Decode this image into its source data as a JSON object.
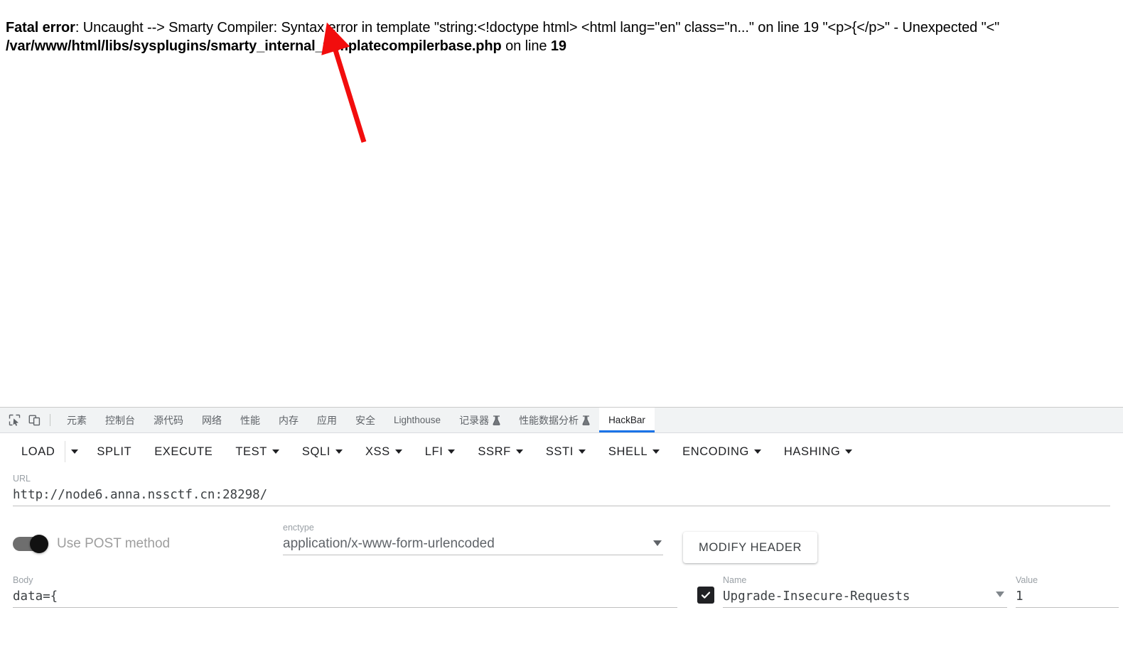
{
  "page": {
    "error": {
      "line1_segments": [
        {
          "text": "Fatal error",
          "bold": true
        },
        {
          "text": ": Uncaught --> Smarty Compiler: Syntax error in template \"string:<!doctype html>  <html lang=\"en\" class=\"n...\" on line 19 \"<p>{</p>\" - Unexpected \"<\"",
          "bold": false
        }
      ],
      "line2_segments": [
        {
          "text": "/var/www/html/libs/sysplugins/smarty_internal_templatecompilerbase.php",
          "bold": true
        },
        {
          "text": " on line ",
          "bold": false
        },
        {
          "text": "19",
          "bold": true
        }
      ]
    },
    "annotation": {
      "arrow_color": "#f20d0d"
    }
  },
  "devtools": {
    "icons": [
      {
        "name": "inspect-element-icon",
        "label": "Inspect element"
      },
      {
        "name": "device-toolbar-icon",
        "label": "Toggle device toolbar"
      }
    ],
    "tabs": [
      {
        "label": "元素",
        "active": false,
        "flask": false,
        "cjk": true
      },
      {
        "label": "控制台",
        "active": false,
        "flask": false,
        "cjk": true
      },
      {
        "label": "源代码",
        "active": false,
        "flask": false,
        "cjk": true
      },
      {
        "label": "网络",
        "active": false,
        "flask": false,
        "cjk": true
      },
      {
        "label": "性能",
        "active": false,
        "flask": false,
        "cjk": true
      },
      {
        "label": "内存",
        "active": false,
        "flask": false,
        "cjk": true
      },
      {
        "label": "应用",
        "active": false,
        "flask": false,
        "cjk": true
      },
      {
        "label": "安全",
        "active": false,
        "flask": false,
        "cjk": true
      },
      {
        "label": "Lighthouse",
        "active": false,
        "flask": false,
        "cjk": false
      },
      {
        "label": "记录器",
        "active": false,
        "flask": true,
        "cjk": true
      },
      {
        "label": "性能数据分析",
        "active": false,
        "flask": true,
        "cjk": true
      },
      {
        "label": "HackBar",
        "active": true,
        "flask": false,
        "cjk": false
      }
    ],
    "active_tab_accent": "#1a73e8"
  },
  "hackbar": {
    "toolbar": [
      {
        "label": "LOAD",
        "caret": false,
        "split_caret": true
      },
      {
        "label": "SPLIT",
        "caret": false,
        "split_caret": false
      },
      {
        "label": "EXECUTE",
        "caret": false,
        "split_caret": false
      },
      {
        "label": "TEST",
        "caret": true,
        "split_caret": false
      },
      {
        "label": "SQLI",
        "caret": true,
        "split_caret": false
      },
      {
        "label": "XSS",
        "caret": true,
        "split_caret": false
      },
      {
        "label": "LFI",
        "caret": true,
        "split_caret": false
      },
      {
        "label": "SSRF",
        "caret": true,
        "split_caret": false
      },
      {
        "label": "SSTI",
        "caret": true,
        "split_caret": false
      },
      {
        "label": "SHELL",
        "caret": true,
        "split_caret": false
      },
      {
        "label": "ENCODING",
        "caret": true,
        "split_caret": false
      },
      {
        "label": "HASHING",
        "caret": true,
        "split_caret": false
      }
    ],
    "url_field": {
      "label": "URL",
      "value": "http://node6.anna.nssctf.cn:28298/"
    },
    "post_toggle": {
      "label": "Use POST method",
      "enabled": true
    },
    "enctype_field": {
      "label": "enctype",
      "value": "application/x-www-form-urlencoded"
    },
    "modify_header": {
      "label": "MODIFY HEADER"
    },
    "body_field": {
      "label": "Body",
      "value": "data={"
    },
    "header_row": {
      "checkbox_checked": true,
      "name_label": "Name",
      "name_value": "Upgrade-Insecure-Requests",
      "value_label": "Value",
      "value_value": "1"
    }
  }
}
